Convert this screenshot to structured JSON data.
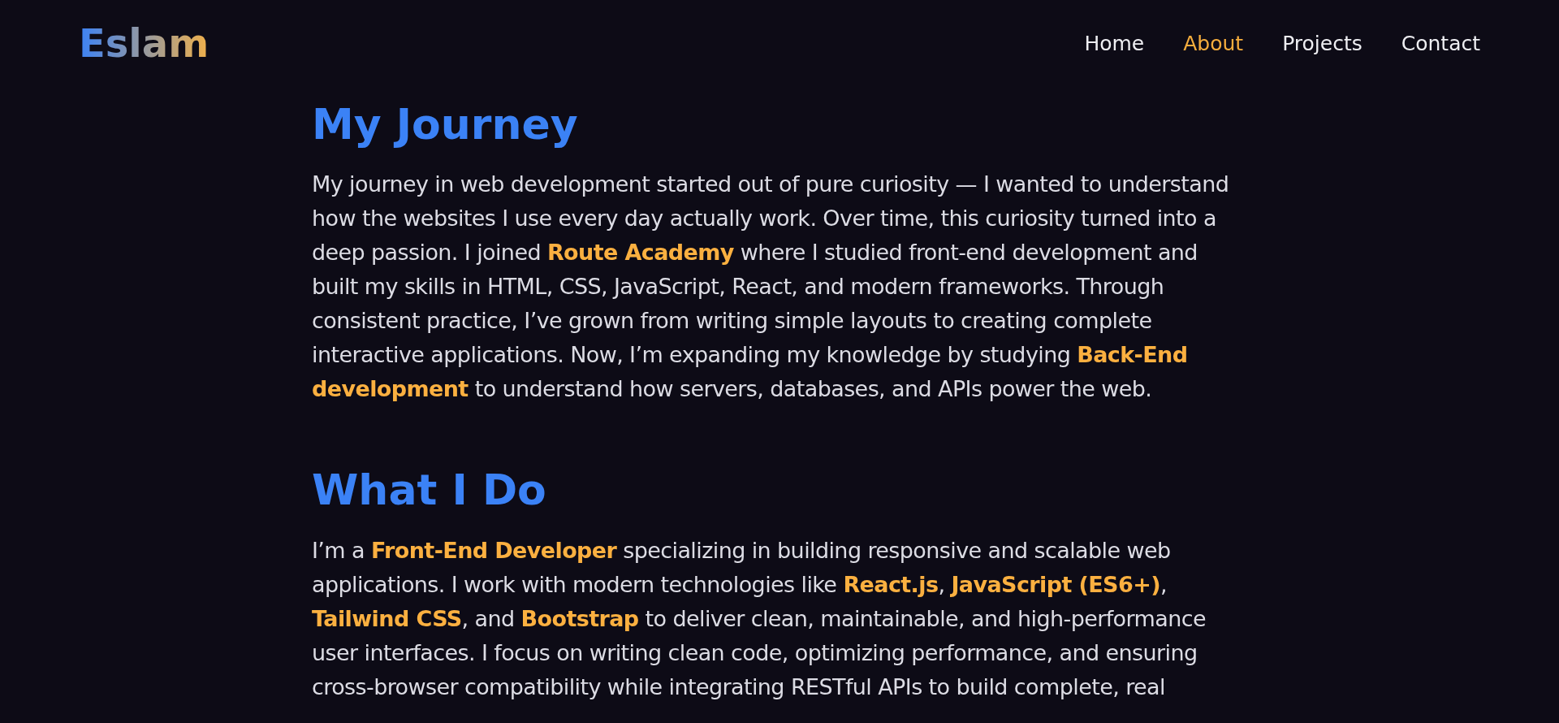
{
  "header": {
    "logo": "Eslam",
    "nav": [
      {
        "label": "Home",
        "selected": false
      },
      {
        "label": "About",
        "selected": true
      },
      {
        "label": "Projects",
        "selected": false
      },
      {
        "label": "Contact",
        "selected": false
      }
    ]
  },
  "sections": [
    {
      "heading": "My Journey",
      "text": "My journey in web development started out of pure curiosity — I wanted to understand how the websites I use every day actually work. Over time, this curiosity turned into a deep passion. I joined **Route Academy** where I studied front-end development and built my skills in HTML, CSS, JavaScript, React, and modern frameworks. Through consistent practice, I’ve grown from writing simple layouts to creating complete interactive applications. Now, I’m expanding my knowledge by studying **Back-End development** to understand how servers, databases, and APIs power the web."
    },
    {
      "heading": "What I Do",
      "text": "I’m a **Front-End Developer** specializing in building responsive and scalable web applications. I work with modern technologies like **React.js**, **JavaScript (ES6+)**, **Tailwind CSS**, and **Bootstrap** to deliver clean, maintainable, and high-performance user interfaces. I focus on writing clean code, optimizing performance, and ensuring cross-browser compatibility while integrating RESTful APIs to build complete, real"
    }
  ]
}
